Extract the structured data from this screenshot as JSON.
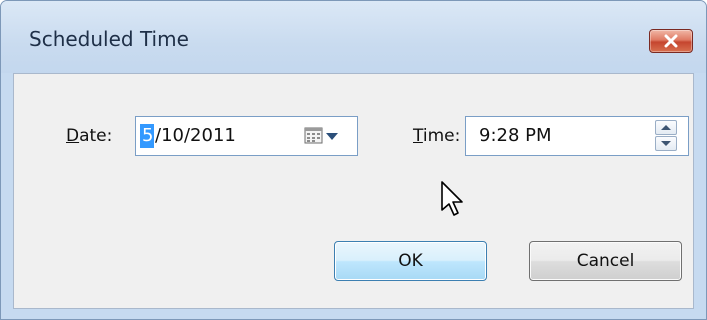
{
  "window": {
    "title": "Scheduled Time",
    "close_icon": "close-x-icon"
  },
  "date": {
    "label_mnemonic": "D",
    "label_rest": "ate:",
    "value_selected": "5",
    "value_rest": "/10/2011",
    "dropdown_icon": "calendar-icon"
  },
  "time": {
    "label_mnemonic": "T",
    "label_rest": "ime:",
    "value": "9:28 PM",
    "spinner_icons": [
      "chevron-up-icon",
      "chevron-down-icon"
    ]
  },
  "buttons": {
    "ok_label": "OK",
    "cancel_label": "Cancel"
  },
  "colors": {
    "selection": "#3399ff",
    "ok_button": "#bee6fd",
    "title_bar": "#c9dbef",
    "close_button": "#c5452f"
  }
}
